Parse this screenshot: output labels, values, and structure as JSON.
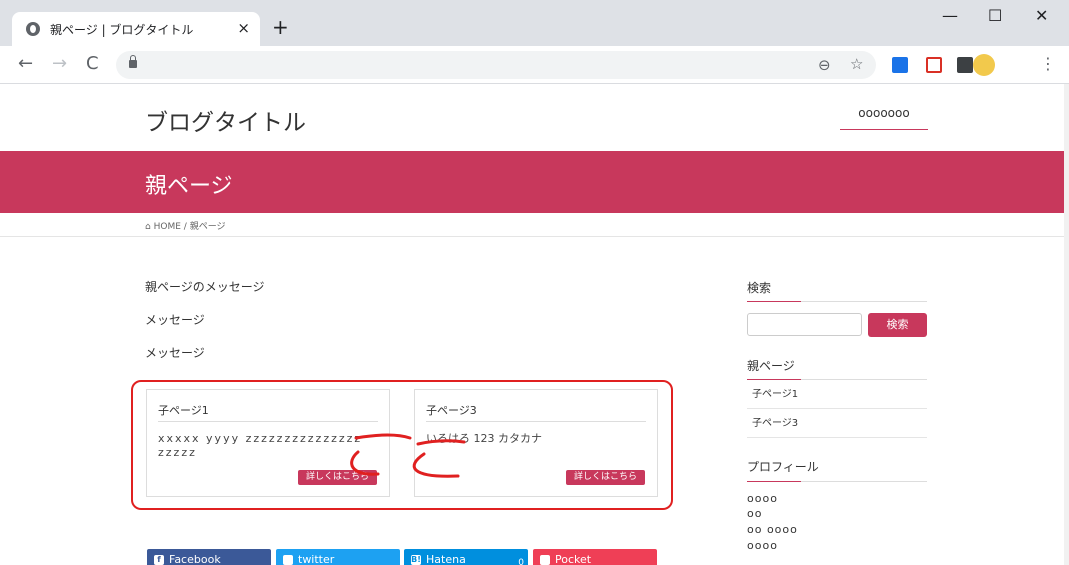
{
  "browser": {
    "tab_title": "親ページ | ブログタイトル",
    "tab_close": "×",
    "new_tab": "+",
    "minimize": "—",
    "maximize": "☐",
    "close": "✕",
    "back": "←",
    "forward": "→",
    "reload": "C",
    "zoom_icon": "⊖",
    "star_icon": "☆",
    "menu_icon": "⋮",
    "url": ""
  },
  "site": {
    "title": "ブログタイトル",
    "nav_item": "ooooooo"
  },
  "banner": {
    "title": "親ページ"
  },
  "breadcrumb": {
    "home_icon": "⌂",
    "home": "HOME",
    "sep": "/",
    "current": "親ページ"
  },
  "content": {
    "messages": [
      "親ページのメッセージ",
      "メッセージ",
      "メッセージ"
    ],
    "cards": [
      {
        "title": "子ページ1",
        "body": "xxxxx yyyy zzzzzzzzzzzzzzz zzzzz",
        "button": "詳しくはこちら"
      },
      {
        "title": "子ページ3",
        "body": "いろはろ 123 カタカナ",
        "button": "詳しくはこちら"
      }
    ],
    "annotation": "ここ"
  },
  "share": {
    "facebook": "Facebook",
    "twitter": "twitter",
    "hatena": "Hatena",
    "hatena_count": "0",
    "pocket": "Pocket",
    "colors": {
      "facebook": "#3b5998",
      "twitter": "#1da1f2",
      "hatena": "#008fde",
      "pocket": "#ef3f56"
    }
  },
  "sidebar": {
    "search_heading": "検索",
    "search_button": "検索",
    "search_placeholder": "",
    "pages_heading": "親ページ",
    "pages": [
      "子ページ1",
      "子ページ3"
    ],
    "profile_heading": "プロフィール",
    "profile_lines": [
      "oooo",
      "oo",
      "oo oooo",
      "oooo"
    ]
  },
  "colors": {
    "accent": "#c8385c",
    "annotation": "#e02020"
  }
}
